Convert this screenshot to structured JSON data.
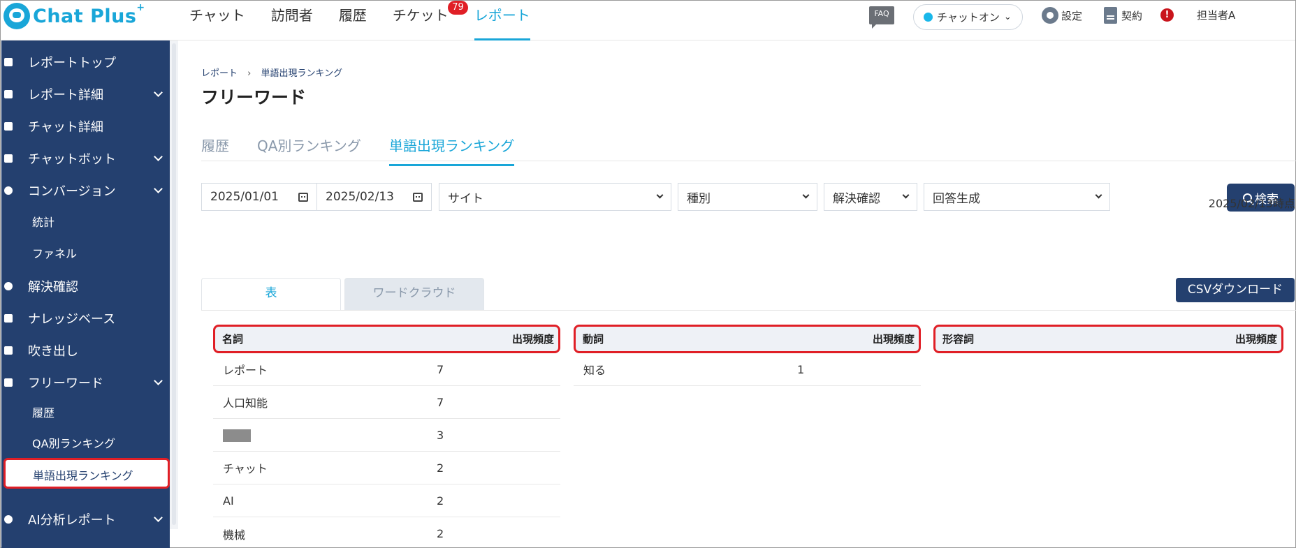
{
  "app": {
    "logo_text": "Chat Plus",
    "logo_plus": "+",
    "nav": [
      {
        "label": "チャット"
      },
      {
        "label": "訪問者"
      },
      {
        "label": "履歴"
      },
      {
        "label": "チケット",
        "badge": "79"
      },
      {
        "label": "レポート",
        "active": true
      }
    ],
    "faq_label": "FAQ",
    "chat_status": "チャットオン",
    "settings_label": "設定",
    "contract_label": "契約",
    "alert_symbol": "!",
    "user_name": "担当者A"
  },
  "sidebar": {
    "items": [
      {
        "label": "レポートトップ"
      },
      {
        "label": "レポート詳細"
      },
      {
        "label": "チャット詳細"
      },
      {
        "label": "チャットボット"
      },
      {
        "label": "コンバージョン"
      },
      {
        "label": "統計"
      },
      {
        "label": "ファネル"
      },
      {
        "label": "解決確認"
      },
      {
        "label": "ナレッジベース"
      },
      {
        "label": "吹き出し"
      },
      {
        "label": "フリーワード"
      },
      {
        "label": "履歴"
      },
      {
        "label": "QA別ランキング"
      },
      {
        "label": "単語出現ランキング"
      },
      {
        "label": "AI分析レポート"
      }
    ]
  },
  "main": {
    "breadcrumb": [
      "レポート",
      "単語出現ランキング"
    ],
    "breadcrumb_sep": "›",
    "title": "フリーワード",
    "tabs": [
      {
        "label": "履歴"
      },
      {
        "label": "QA別ランキング"
      },
      {
        "label": "単語出現ランキング",
        "active": true
      }
    ],
    "filters": {
      "date_from": "2025/01/01",
      "date_to": "2025/02/13",
      "site": "サイト",
      "type": "種別",
      "resolution": "解決確認",
      "answer": "回答生成",
      "search_label": "検索"
    },
    "timestamp": "2025/02/13時点",
    "view_tabs": [
      {
        "label": "表",
        "active": true
      },
      {
        "label": "ワードクラウド"
      }
    ],
    "csv_label": "CSVダウンロード",
    "tables": {
      "noun": {
        "header": "名詞",
        "count_header": "出現頻度",
        "rows": [
          {
            "word": "レポート",
            "count": "7"
          },
          {
            "word": "人口知能",
            "count": "7"
          },
          {
            "word": "",
            "count": "3"
          },
          {
            "word": "チャット",
            "count": "2"
          },
          {
            "word": "AI",
            "count": "2"
          },
          {
            "word": "機械",
            "count": "2"
          }
        ]
      },
      "verb": {
        "header": "動詞",
        "count_header": "出現頻度",
        "rows": [
          {
            "word": "知る",
            "count": "1"
          }
        ]
      },
      "adjective": {
        "header": "形容詞",
        "count_header": "出現頻度",
        "rows": []
      }
    }
  }
}
